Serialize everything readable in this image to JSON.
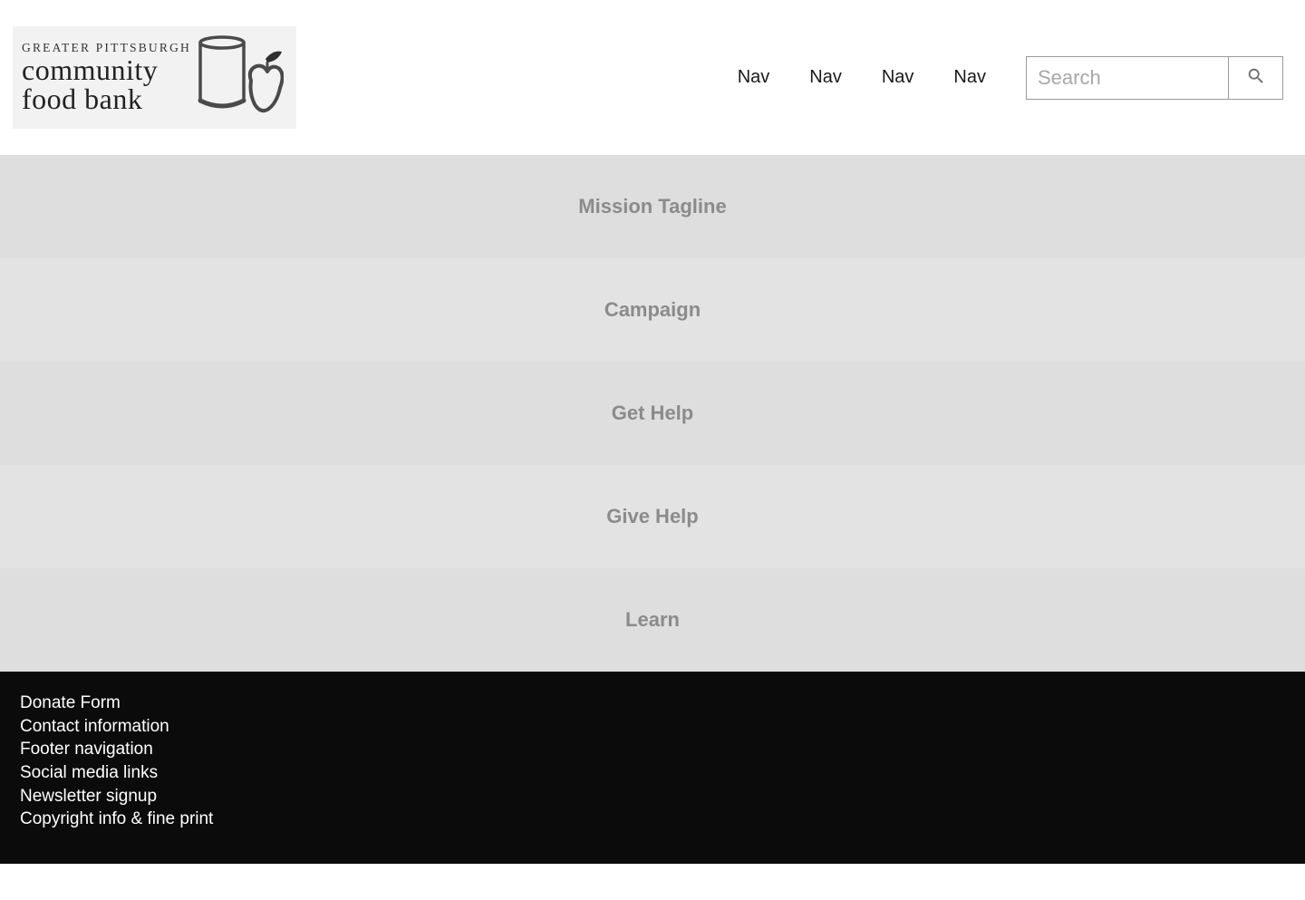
{
  "logo": {
    "line1": "GREATER PITTSBURGH",
    "line2": "community",
    "line3": "food bank"
  },
  "nav": {
    "items": [
      {
        "label": "Nav"
      },
      {
        "label": "Nav"
      },
      {
        "label": "Nav"
      },
      {
        "label": "Nav"
      }
    ]
  },
  "search": {
    "placeholder": "Search"
  },
  "sections": [
    {
      "label": "Mission Tagline"
    },
    {
      "label": "Campaign"
    },
    {
      "label": "Get Help"
    },
    {
      "label": "Give Help"
    },
    {
      "label": "Learn"
    }
  ],
  "footer": {
    "items": [
      {
        "label": "Donate Form"
      },
      {
        "label": "Contact information"
      },
      {
        "label": "Footer navigation"
      },
      {
        "label": "Social media links"
      },
      {
        "label": "Newsletter signup"
      },
      {
        "label": "Copyright info & fine print"
      }
    ]
  }
}
